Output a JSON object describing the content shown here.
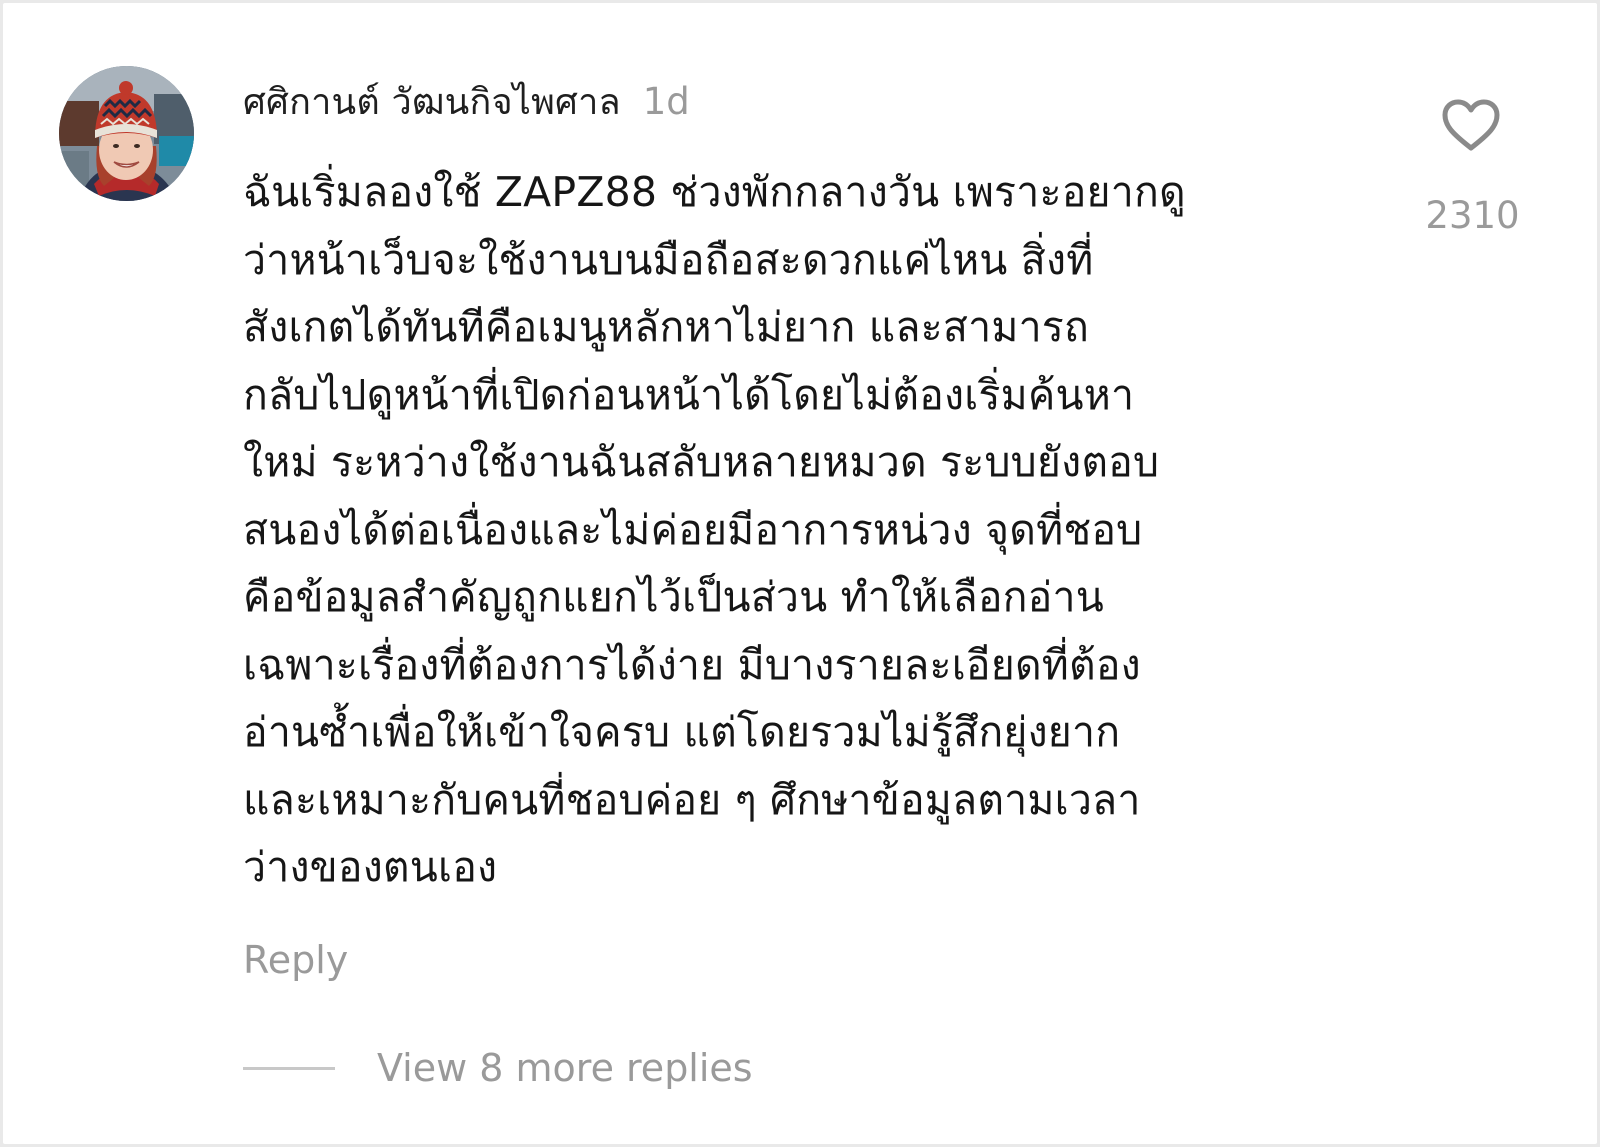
{
  "comment": {
    "username": "ศศิกานต์ วัฒนกิจไพศาล",
    "time": "1d",
    "text": "ฉันเริ่มลองใช้ ZAPZ88 ช่วงพักกลางวัน เพราะอยากดู\nว่าหน้าเว็บจะใช้งานบนมือถือสะดวกแค่ไหน สิ่งที่\nสังเกตได้ทันทีคือเมนูหลักหาไม่ยาก และสามารถ\nกลับไปดูหน้าที่เปิดก่อนหน้าได้โดยไม่ต้องเริ่มค้นหา\nใหม่ ระหว่างใช้งานฉันสลับหลายหมวด ระบบยังตอบ\nสนองได้ต่อเนื่องและไม่ค่อยมีอาการหน่วง จุดที่ชอบ\nคือข้อมูลสำคัญถูกแยกไว้เป็นส่วน ทำให้เลือกอ่าน\nเฉพาะเรื่องที่ต้องการได้ง่าย มีบางรายละเอียดที่ต้อง\nอ่านซ้ำเพื่อให้เข้าใจครบ แต่โดยรวมไม่รู้สึกยุ่งยาก\nและเหมาะกับคนที่ชอบค่อย ๆ ศึกษาข้อมูลตามเวลา\nว่างของตนเอง",
    "like_count": "2310",
    "reply_label": "Reply",
    "view_replies_label": "View 8 more replies",
    "heart_icon": "heart-outline-icon"
  },
  "colors": {
    "background": "#ffffff",
    "text_primary": "#161616",
    "text_secondary": "#9a9a9a",
    "heart_stroke": "#8a8a8a",
    "divider": "#c8c8c8"
  }
}
